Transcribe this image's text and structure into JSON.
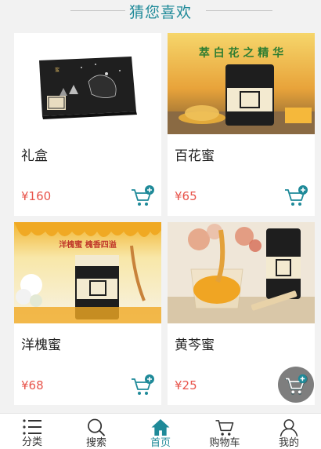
{
  "section": {
    "title": "猜您喜欢"
  },
  "products": [
    {
      "name": "礼盒",
      "price": "¥160",
      "image": "black-gift-box"
    },
    {
      "name": "百花蜜",
      "price": "¥65",
      "image": "wildflower-honey-jar",
      "banner_text": "萃 白 花 之 精 华"
    },
    {
      "name": "洋槐蜜",
      "price": "¥68",
      "image": "acacia-honey-jar",
      "banner_text": "洋槐蜜 槐香四溢"
    },
    {
      "name": "黄芩蜜",
      "price": "¥25",
      "image": "scutellaria-honey-jar"
    }
  ],
  "tabs": [
    {
      "label": "分类",
      "icon": "list-icon",
      "active": false
    },
    {
      "label": "搜索",
      "icon": "search-icon",
      "active": false
    },
    {
      "label": "首页",
      "icon": "home-icon",
      "active": true
    },
    {
      "label": "购物车",
      "icon": "cart-icon",
      "active": false
    },
    {
      "label": "我的",
      "icon": "user-icon",
      "active": false
    }
  ],
  "colors": {
    "accent": "#1f8a99",
    "price": "#e8544b",
    "background": "#f2f2f2"
  }
}
